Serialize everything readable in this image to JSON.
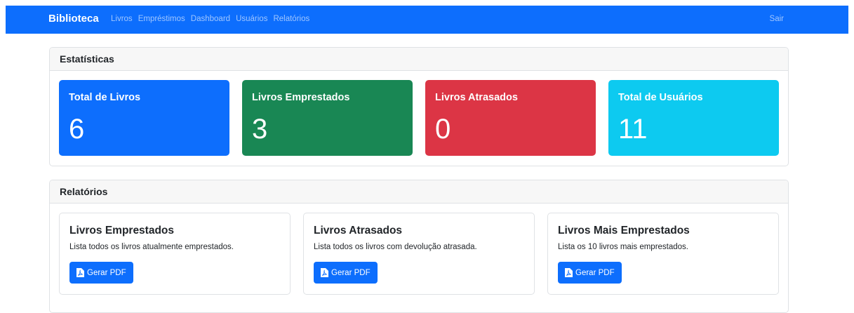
{
  "navbar": {
    "brand": "Biblioteca",
    "links": [
      "Livros",
      "Empréstimos",
      "Dashboard",
      "Usuários",
      "Relatórios"
    ],
    "logout": "Sair"
  },
  "stats": {
    "header": "Estatísticas",
    "cards": [
      {
        "title": "Total de Livros",
        "value": "6",
        "color": "#0d6efd"
      },
      {
        "title": "Livros Emprestados",
        "value": "3",
        "color": "#198754"
      },
      {
        "title": "Livros Atrasados",
        "value": "0",
        "color": "#dc3545"
      },
      {
        "title": "Total de Usuários",
        "value": "11",
        "color": "#0dcaf0"
      }
    ]
  },
  "reports": {
    "header": "Relatórios",
    "cards": [
      {
        "title": "Livros Emprestados",
        "description": "Lista todos os livros atualmente emprestados.",
        "button": "Gerar PDF"
      },
      {
        "title": "Livros Atrasados",
        "description": "Lista todos os livros com devolução atrasada.",
        "button": "Gerar PDF"
      },
      {
        "title": "Livros Mais Emprestados",
        "description": "Lista os 10 livros mais emprestados.",
        "button": "Gerar PDF"
      }
    ],
    "button_icon": "file-pdf-icon"
  }
}
